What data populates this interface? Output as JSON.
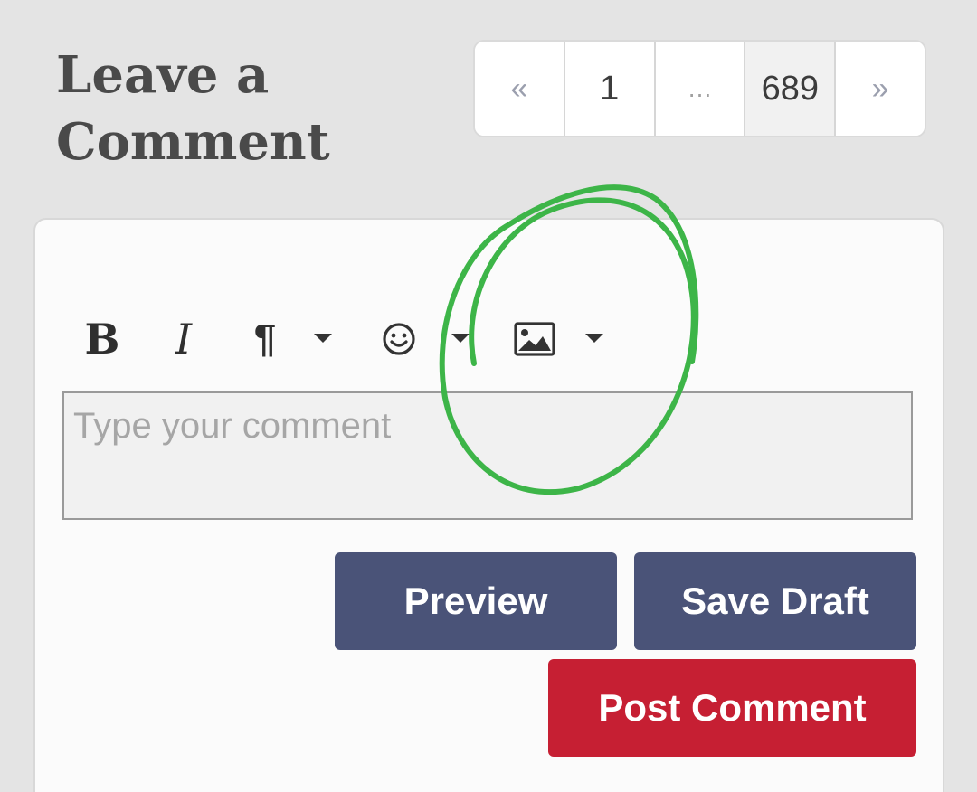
{
  "heading": "Leave a Comment",
  "pagination": {
    "prev_label": "«",
    "first_page": "1",
    "ellipsis": "…",
    "last_page": "689",
    "next_label": "»"
  },
  "toolbar": {
    "bold_label": "B",
    "italic_label": "I",
    "paragraph_label": "¶",
    "icons": [
      "bold-icon",
      "italic-icon",
      "paragraph-icon",
      "emoji-icon",
      "image-icon",
      "chevron-down-icon"
    ]
  },
  "comment": {
    "placeholder": "Type your comment",
    "value": ""
  },
  "buttons": {
    "preview": "Preview",
    "save_draft": "Save Draft",
    "post_comment": "Post Comment"
  },
  "colors": {
    "background": "#e4e4e4",
    "heading": "#4a4a4a",
    "secondary_button": "#4a5378",
    "primary_button": "#c61f33",
    "annotation": "#3db548"
  }
}
